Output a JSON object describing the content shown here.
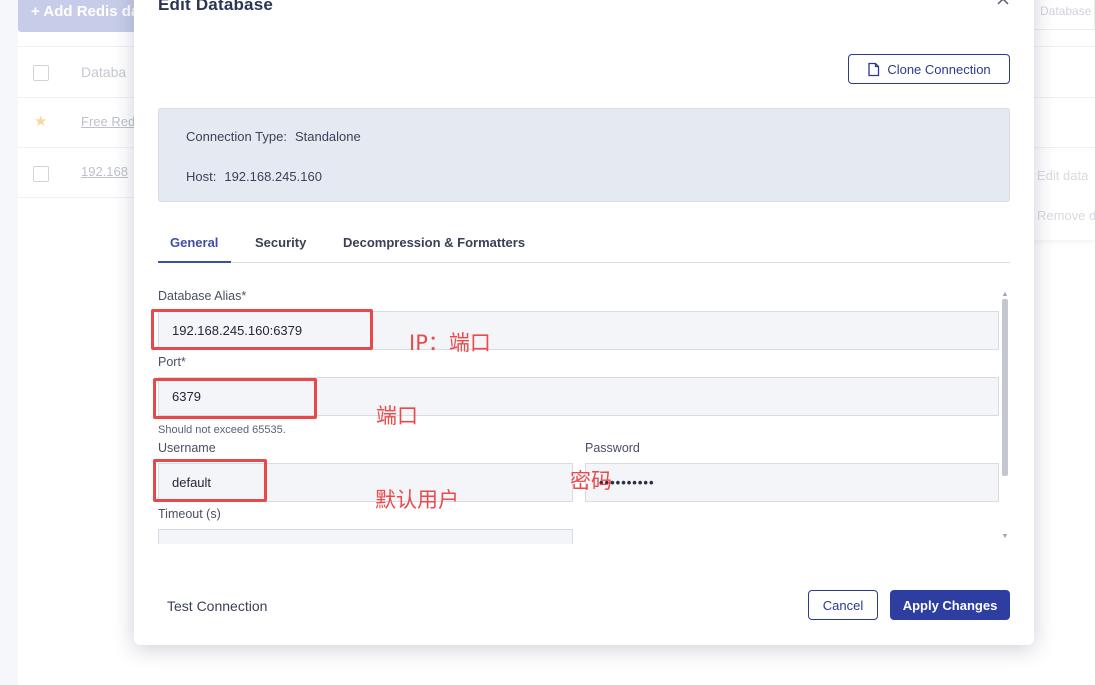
{
  "background": {
    "add_button_label": "+ Add Redis da",
    "search_placeholder": "Database",
    "table": {
      "header_label": "Databa",
      "rows": [
        {
          "label": "Free Red",
          "starred": true
        },
        {
          "label": "192.168",
          "starred": false
        }
      ]
    },
    "row_menu": {
      "edit_label": "Edit data",
      "remove_label": "Remove d"
    }
  },
  "modal": {
    "title": "Edit Database",
    "close_icon": "close-icon",
    "clone_button_label": "Clone Connection",
    "connection_info": {
      "type_label": "Connection Type:",
      "type_value": "Standalone",
      "host_label": "Host:",
      "host_value": "192.168.245.160"
    },
    "tabs": [
      {
        "label": "General",
        "active": true
      },
      {
        "label": "Security",
        "active": false
      },
      {
        "label": "Decompression & Formatters",
        "active": false
      }
    ],
    "form": {
      "alias_label": "Database Alias*",
      "alias_value": "192.168.245.160:6379",
      "port_label": "Port*",
      "port_value": "6379",
      "port_hint": "Should not exceed 65535.",
      "username_label": "Username",
      "username_value": "default",
      "password_label": "Password",
      "password_value": "••••••••••",
      "timeout_label": "Timeout (s)",
      "timeout_value": ""
    },
    "footer": {
      "test_connection_label": "Test Connection",
      "cancel_label": "Cancel",
      "apply_label": "Apply Changes"
    }
  },
  "annotations": {
    "color": "#e8484a",
    "alias_note": "IP：端口",
    "port_note": "端口",
    "username_note": "默认用户",
    "password_note": "密码"
  },
  "colors": {
    "primary": "#2d3ea0",
    "info_box_bg": "#e5e9f1",
    "star": "#f1c56b"
  }
}
